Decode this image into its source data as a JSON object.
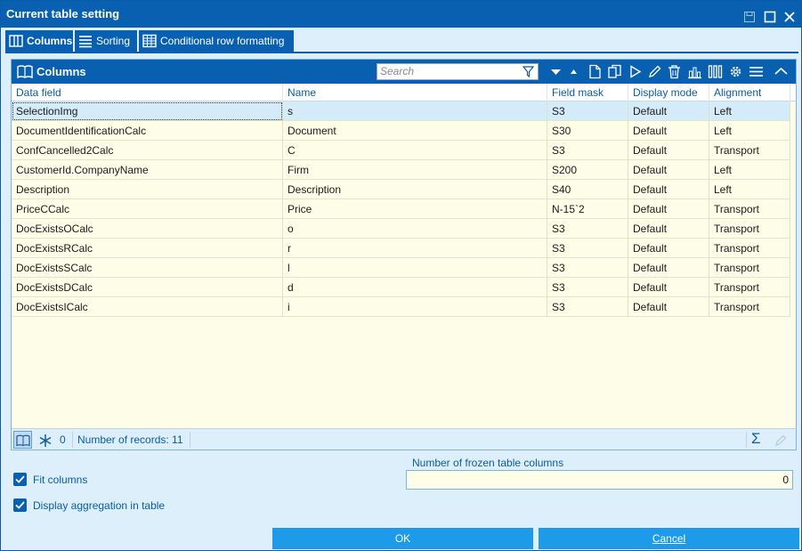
{
  "window": {
    "title": "Current table setting"
  },
  "tabs": [
    {
      "label": "Columns",
      "icon": "columns-icon"
    },
    {
      "label": "Sorting",
      "icon": "sorting-icon"
    },
    {
      "label": "Conditional row formatting",
      "icon": "table-icon"
    }
  ],
  "panel": {
    "title": "Columns",
    "search_placeholder": "Search"
  },
  "grid": {
    "columns": [
      "Data field",
      "Name",
      "Field mask",
      "Display mode",
      "Alignment"
    ],
    "rows": [
      [
        "SelectionImg",
        "s",
        "S3",
        "Default",
        "Left"
      ],
      [
        "DocumentIdentificationCalc",
        "Document",
        "S30",
        "Default",
        "Left"
      ],
      [
        "ConfCancelled2Calc",
        "C",
        "S3",
        "Default",
        "Transport"
      ],
      [
        "CustomerId.CompanyName",
        "Firm",
        "S200",
        "Default",
        "Left"
      ],
      [
        "Description",
        "Description",
        "S40",
        "Default",
        "Left"
      ],
      [
        "PriceCCalc",
        "Price",
        "N-15`2",
        "Default",
        "Transport"
      ],
      [
        "DocExistsOCalc",
        "o",
        "S3",
        "Default",
        "Transport"
      ],
      [
        "DocExistsRCalc",
        "r",
        "S3",
        "Default",
        "Transport"
      ],
      [
        "DocExistsSCalc",
        "l",
        "S3",
        "Default",
        "Transport"
      ],
      [
        "DocExistsDCalc",
        "d",
        "S3",
        "Default",
        "Transport"
      ],
      [
        "DocExistsICalc",
        "i",
        "S3",
        "Default",
        "Transport"
      ]
    ]
  },
  "status": {
    "frozen_count": "0",
    "records_text": "Number of records: 11"
  },
  "options": {
    "fit_columns_label": "Fit columns",
    "display_aggregation_label": "Display aggregation in table",
    "frozen_label": "Number of frozen table columns",
    "frozen_value": "0"
  },
  "buttons": {
    "ok": "OK",
    "cancel": "Cancel"
  },
  "colors": {
    "accent": "#0a60b0",
    "button": "#1e9be8",
    "grid_bg": "#fefee8",
    "selected_row": "#d4ebfa"
  }
}
